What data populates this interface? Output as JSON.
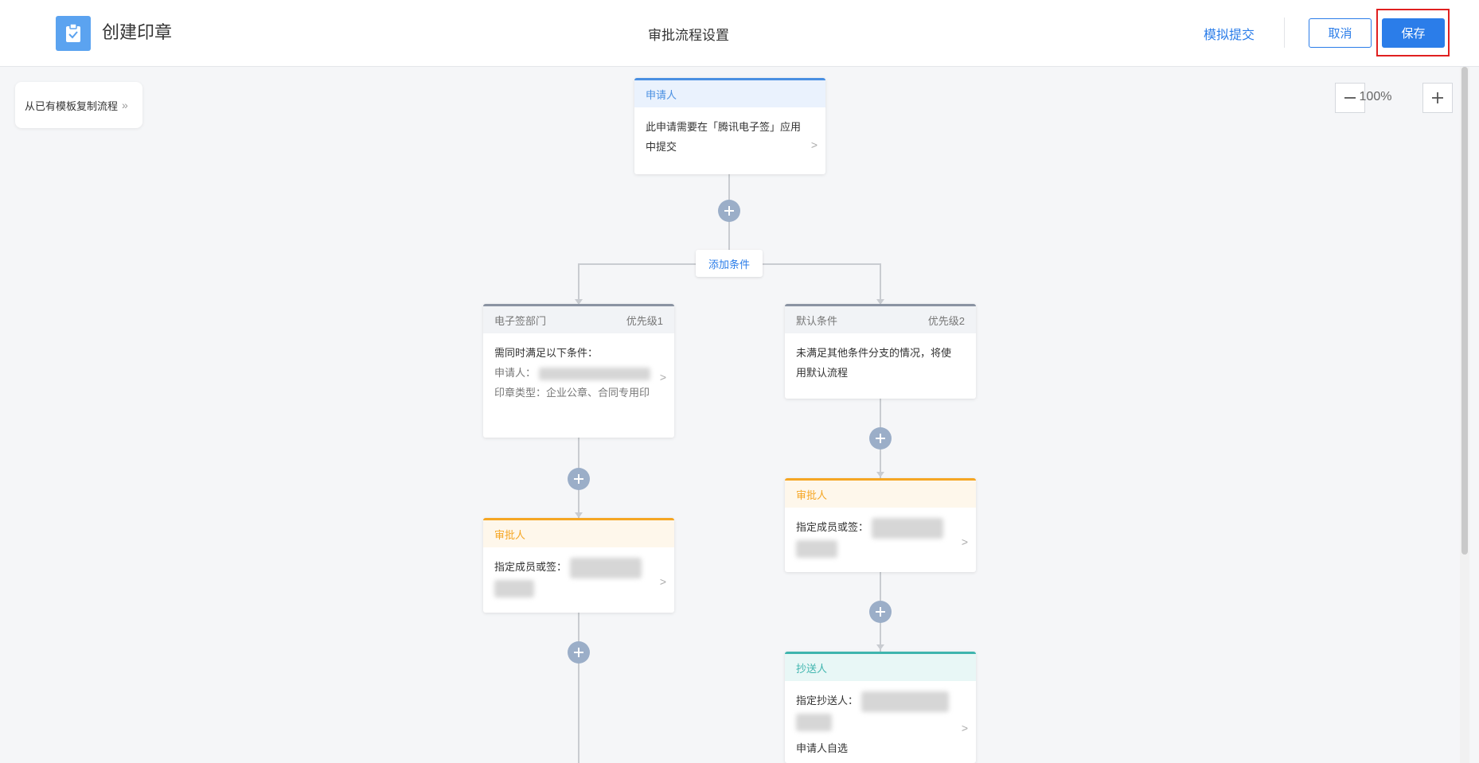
{
  "header": {
    "app_title": "创建印章",
    "page_title": "审批流程设置",
    "simulate_label": "模拟提交",
    "cancel_label": "取消",
    "save_label": "保存"
  },
  "toolbar": {
    "copy_template_label": "从已有模板复制流程",
    "copy_template_icon": "double-chevron-right-icon",
    "zoom_level": "100%"
  },
  "flow": {
    "applicant": {
      "title": "申请人",
      "content": "此申请需要在「腾讯电子签」应用中提交"
    },
    "add_condition_label": "添加条件",
    "branch_left": {
      "condition": {
        "title": "电子签部门",
        "priority": "优先级1",
        "line1": "需同时满足以下条件：",
        "line2": "申请人：",
        "line3": "印章类型：企业公章、合同专用印"
      },
      "approver": {
        "title": "审批人",
        "content": "指定成员或签："
      }
    },
    "branch_right": {
      "condition": {
        "title": "默认条件",
        "priority": "优先级2",
        "content": "未满足其他条件分支的情况，将使用默认流程"
      },
      "approver": {
        "title": "审批人",
        "content": "指定成员或签："
      },
      "cc": {
        "title": "抄送人",
        "content": "指定抄送人：",
        "extra": "申请人自选"
      }
    }
  },
  "colors": {
    "primary": "#2b7de9",
    "applicant_bar": "#4a90e2",
    "condition_bar": "#8a93a2",
    "approver_bar": "#f5a623",
    "cc_bar": "#3fb5ae",
    "add_node": "#9baec8"
  }
}
